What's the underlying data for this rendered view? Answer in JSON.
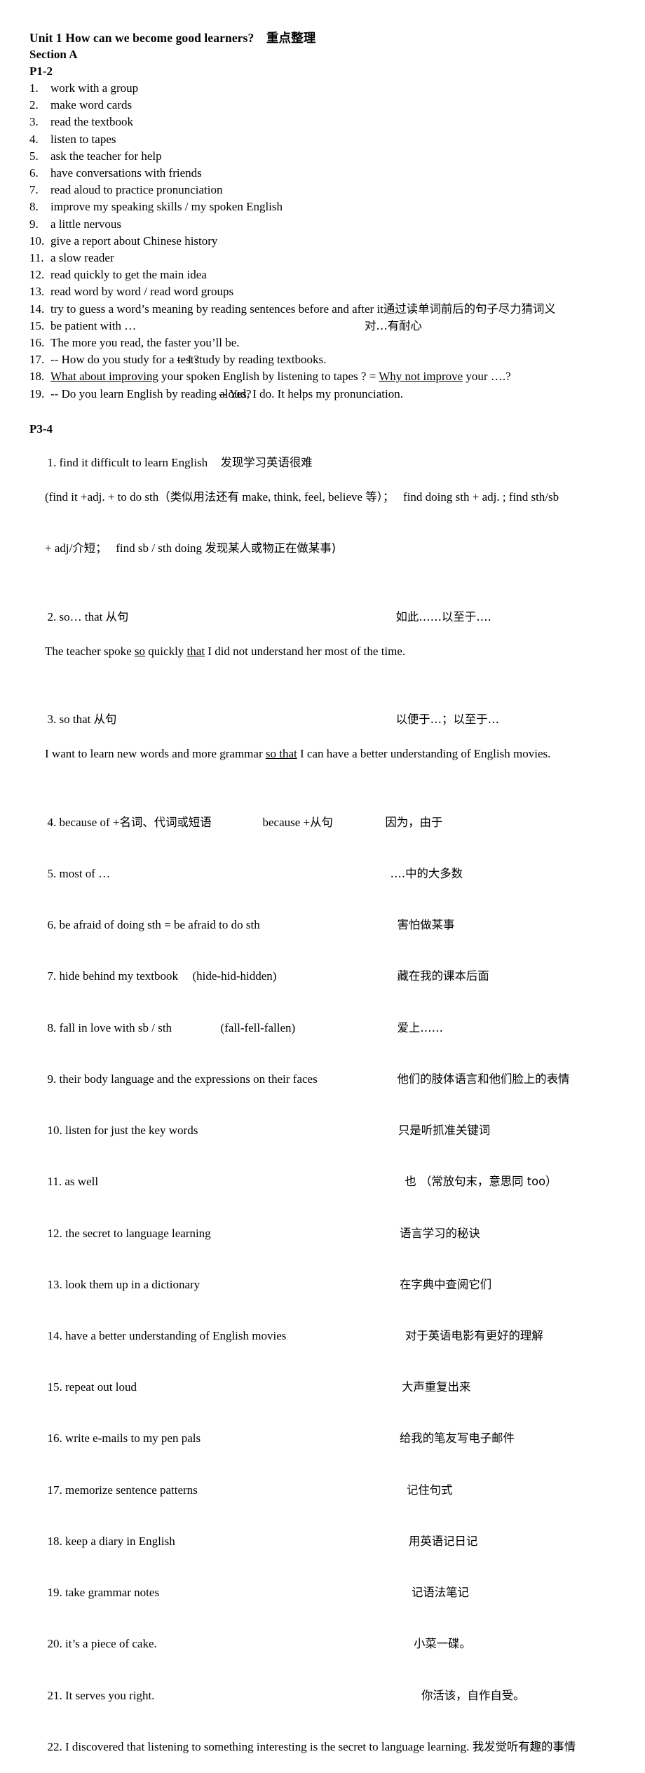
{
  "document": {
    "title": "Unit 1 How can we become good learners?　重点整理",
    "section": "Section A",
    "page_label_1": "P1-2",
    "page_label_2": "P3-4"
  },
  "p1_2_items": [
    {
      "num": "1.",
      "text": "work with a group"
    },
    {
      "num": "2.",
      "text": "make word cards"
    },
    {
      "num": "3.",
      "text": "read the textbook"
    },
    {
      "num": "4.",
      "text": "listen to tapes"
    },
    {
      "num": "5.",
      "text": "ask the teacher for help"
    },
    {
      "num": "6.",
      "text": "have conversations with friends"
    },
    {
      "num": "7.",
      "text": "read aloud to practice pronunciation"
    },
    {
      "num": "8.",
      "text": "improve my speaking skills / my spoken English"
    },
    {
      "num": "9.",
      "text": "a little nervous"
    },
    {
      "num": "10.",
      "text": "give a report about Chinese history"
    },
    {
      "num": "11.",
      "text": "a slow reader"
    },
    {
      "num": "12.",
      "text": "read quickly to get the main idea"
    },
    {
      "num": "13.",
      "text": "read word by word / read word groups"
    },
    {
      "num": "14.",
      "text": "try to guess a word’s meaning by reading sentences before and after it",
      "cn": "通过读单词前后的句子尽力猜词义"
    },
    {
      "num": "15.",
      "text": "be patient with …",
      "cn": "对…有耐心"
    },
    {
      "num": "16.",
      "text": "The more you read, the faster you’ll be."
    },
    {
      "num": "17.",
      "text": "-- How do you study for a test?",
      "text2": "-- I study by reading textbooks."
    },
    {
      "num": "18.",
      "u1": "What about improving",
      "mid": " your spoken English by listening to tapes ? = ",
      "u2": "Why not improve",
      "tail": " your ….?"
    },
    {
      "num": "19.",
      "text": "-- Do you learn English by reading aloud?",
      "text2": "-- Yes, I do. It helps my pronunciation."
    }
  ],
  "p3_4_items": [
    {
      "num": "1.",
      "en": "find it difficult to learn English",
      "cn": "发现学习英语很难",
      "note_line1_a": "(find it +adj. + to do sth",
      "note_line1_cn": "（类似用法还有",
      "note_line1_b": " make, think, feel, believe ",
      "note_line1_cn2": "等）；",
      "note_line1_c": "find doing sth + adj. ; find sth/sb",
      "note_line2_a": "+ adj/",
      "note_line2_cn": "介短；",
      "note_line2_b": "find sb / sth doing",
      "note_line2_cn2": "发现某人或物正在做某事)"
    },
    {
      "num": "2.",
      "en": "so… that ",
      "en_cn": "从句",
      "cn": "如此……以至于….",
      "example_a": "The teacher spoke ",
      "example_u1": "so",
      "example_b": " quickly ",
      "example_u2": "that",
      "example_c": " I did not understand her most of the time."
    },
    {
      "num": "3.",
      "en": "so that ",
      "en_cn": "从句",
      "cn": "以便于…；以至于…",
      "example_a": "I want to learn new words and more grammar ",
      "example_u1": "so that",
      "example_c": " I can have a better understanding of English movies."
    },
    {
      "num": "4.",
      "en": "because of +",
      "en_cn": "名词、代词或短语",
      "en2": "because +",
      "en2_cn": "从句",
      "cn": "因为，由于"
    },
    {
      "num": "5.",
      "en": "most of …",
      "cn": "….中的大多数"
    },
    {
      "num": "6.",
      "en": "be afraid of doing sth = be afraid to do sth",
      "cn": "害怕做某事"
    },
    {
      "num": "7.",
      "en": "hide behind my textbook",
      "en2": "(hide-hid-hidden)",
      "cn": "藏在我的课本后面"
    },
    {
      "num": "8.",
      "en": "fall in love with sb / sth",
      "en2": "(fall-fell-fallen)",
      "cn": "爱上……"
    },
    {
      "num": "9.",
      "en": "their body language and the expressions on their faces",
      "cn": "他们的肢体语言和他们脸上的表情"
    },
    {
      "num": "10.",
      "en": "listen for just the key words",
      "cn": "只是听抓准关键词"
    },
    {
      "num": "11.",
      "en": "as well",
      "cn": "也 （常放句末，意思同 too）"
    },
    {
      "num": "12.",
      "en": "the secret to language learning",
      "cn": "语言学习的秘诀"
    },
    {
      "num": "13.",
      "en": "look them up in a dictionary",
      "cn": "在字典中查阅它们"
    },
    {
      "num": "14.",
      "en": "have a better understanding of English movies",
      "cn": "对于英语电影有更好的理解"
    },
    {
      "num": "15.",
      "en": "repeat out loud",
      "cn": "大声重复出来"
    },
    {
      "num": "16.",
      "en": "write e-mails to my pen pals",
      "cn": "给我的笔友写电子邮件"
    },
    {
      "num": "17.",
      "en": "memorize sentence patterns",
      "cn": "记住句式"
    },
    {
      "num": "18.",
      "en": "keep a diary in English",
      "cn": "用英语记日记"
    },
    {
      "num": "19.",
      "en": "take grammar notes",
      "cn": "记语法笔记"
    },
    {
      "num": "20.",
      "en": "it’s a piece of cake.",
      "cn": "小菜一碟。"
    },
    {
      "num": "21.",
      "en": "It serves you right.",
      "cn": "你活该，自作自受。"
    },
    {
      "num": "22.",
      "en": "I discovered that listening to something interesting is the secret to language learning.",
      "cn": "我发觉听有趣的事情"
    }
  ]
}
